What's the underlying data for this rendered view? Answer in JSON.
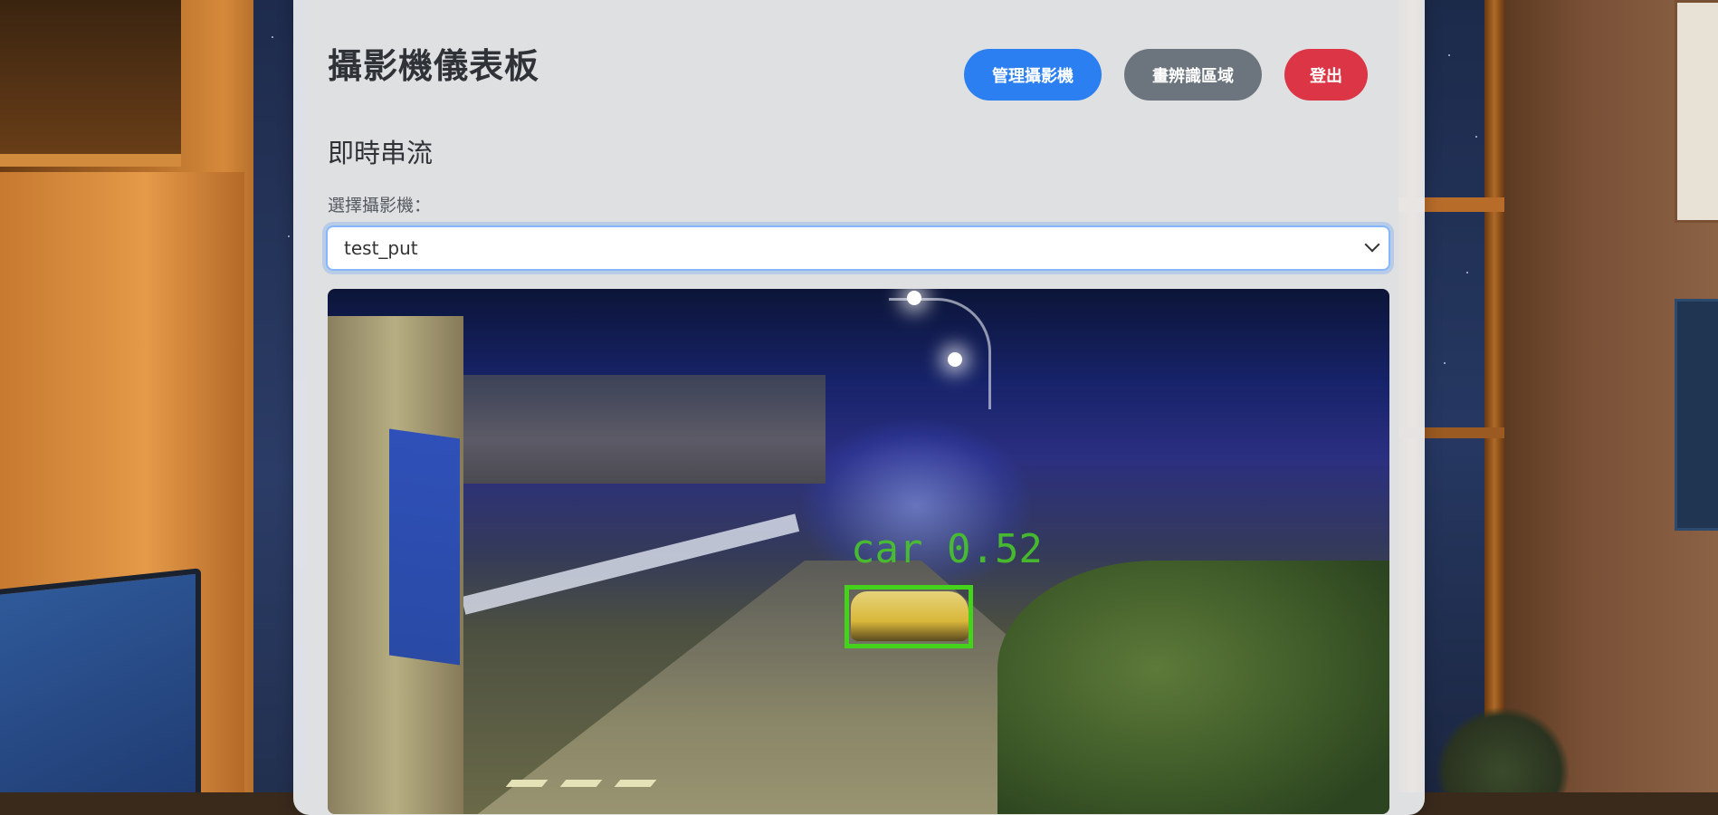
{
  "header": {
    "title": "攝影機儀表板",
    "buttons": {
      "manage": "管理攝影機",
      "draw": "畫辨識區域",
      "logout": "登出"
    }
  },
  "stream": {
    "subtitle": "即時串流",
    "select_label": "選擇攝影機：",
    "selected_camera": "test_put"
  },
  "video": {
    "detection_label": "car 0.52"
  },
  "colors": {
    "primary": "#2b7ff0",
    "secondary": "#6c757d",
    "danger": "#dc3545",
    "bbox": "#44d21a"
  },
  "icons": {
    "select": "chevron-down-icon"
  }
}
